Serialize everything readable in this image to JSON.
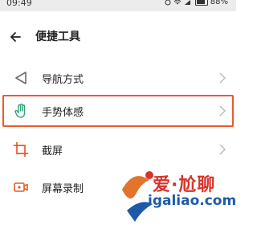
{
  "status": {
    "time": "09:49",
    "battery": "88%"
  },
  "header": {
    "title": "便捷工具"
  },
  "items": [
    {
      "label": "导航方式",
      "icon": "navigation-back-triangle-icon"
    },
    {
      "label": "手势体感",
      "icon": "hand-gesture-icon"
    },
    {
      "label": "截屏",
      "icon": "crop-icon"
    },
    {
      "label": "屏幕录制",
      "icon": "screen-record-icon"
    }
  ],
  "watermark": {
    "line1": "爱·尬聊",
    "line2": "igaliao.com"
  },
  "colors": {
    "highlight": "#e9592d",
    "icon_orange": "#e25b2b",
    "icon_green": "#2fa37a",
    "icon_gray": "#6b6b6b"
  }
}
